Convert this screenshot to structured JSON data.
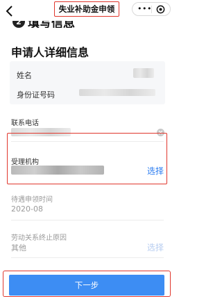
{
  "navbar": {
    "title": "失业补助金申领",
    "menu_dots": "•••"
  },
  "step": {
    "number": "2",
    "title": "填写信息"
  },
  "applicant": {
    "section_title": "申请人详细信息",
    "name_label": "姓名",
    "id_label": "身份证号码"
  },
  "contact": {
    "label": "联系电话"
  },
  "agency": {
    "label": "受理机构",
    "select_label": "选择"
  },
  "pending_period": {
    "label": "待遇申领时间",
    "value": "2020-08"
  },
  "termination_reason": {
    "label": "劳动关系终止原因",
    "value": "其他",
    "select_label": "选择"
  },
  "actions": {
    "next_label": "下一步"
  },
  "colors": {
    "accent_blue": "#3d8df3",
    "link_blue": "#2b7cf0",
    "annotation_red": "#e0362c"
  }
}
